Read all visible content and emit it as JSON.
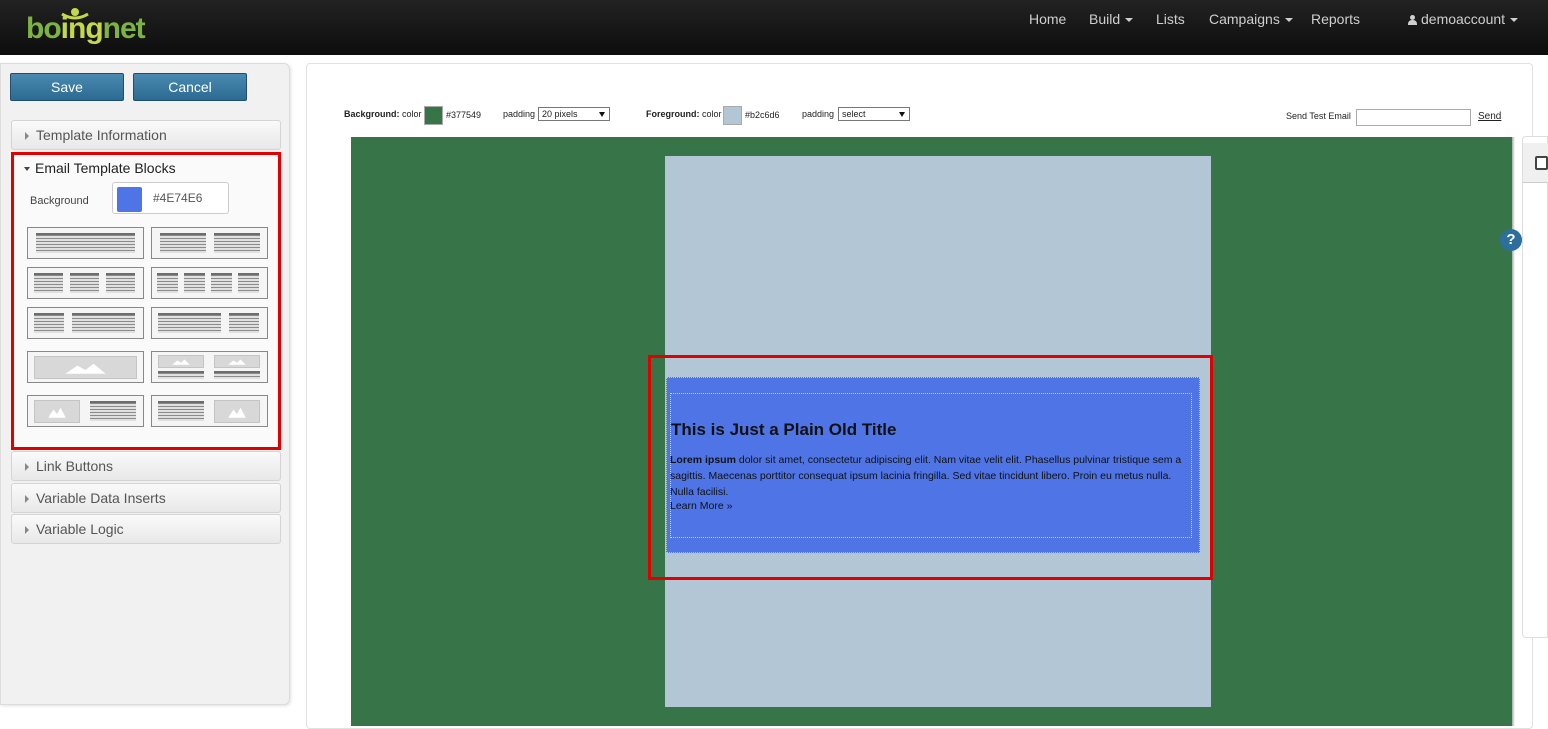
{
  "header": {
    "logo_text_a": "bo",
    "logo_text_b": "ing",
    "logo_text_c": "net",
    "nav": [
      {
        "label": "Home"
      },
      {
        "label": "Build"
      },
      {
        "label": "Lists"
      },
      {
        "label": "Campaigns"
      },
      {
        "label": "Reports"
      }
    ],
    "user": "demoaccount"
  },
  "sidebar": {
    "save_label": "Save",
    "cancel_label": "Cancel",
    "sections": {
      "template_info": "Template Information",
      "blocks": "Email Template Blocks",
      "link_buttons": "Link Buttons",
      "variable_data": "Variable Data Inserts",
      "variable_logic": "Variable Logic"
    },
    "background_label": "Background",
    "background_hex": "#4E74E6",
    "background_color": "#4e74e6"
  },
  "toolbar": {
    "bg_label": "Background:",
    "bg_color_word": "color",
    "bg_hex": "#377549",
    "bg_color": "#377549",
    "padding_word": "padding",
    "bg_padding": "20 pixels",
    "fg_label": "Foreground:",
    "fg_color_word": "color",
    "fg_hex": "#b2c6d6",
    "fg_color": "#b2c6d6",
    "fg_padding_word": "padding",
    "fg_padding": "select",
    "send_test_label": "Send Test Email",
    "send_label": "Send"
  },
  "content": {
    "title": "This is Just a Plain Old Title",
    "lead": "Lorem ipsum",
    "body": " dolor sit amet, consectetur adipiscing elit. Nam vitae velit elit. Phasellus pulvinar tristique sem a sagittis. Maecenas porttitor consequat ipsum lacinia fringilla. Sed vitae tincidunt libero. Proin eu metus nulla. Nulla facilisi.",
    "link": "Learn More »"
  },
  "help_glyph": "?"
}
